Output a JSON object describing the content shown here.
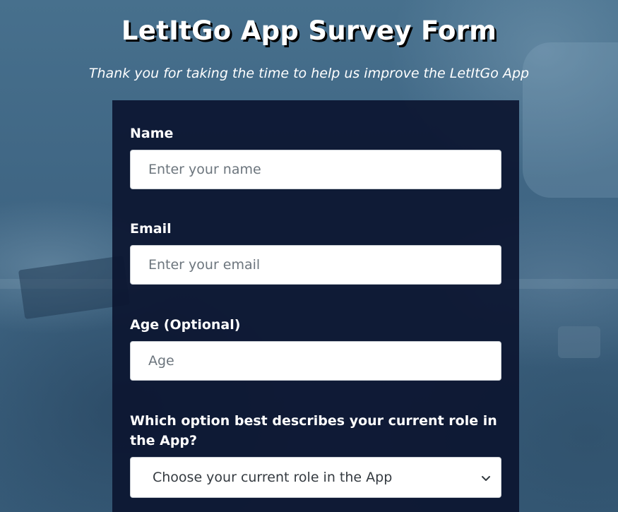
{
  "header": {
    "title": "LetItGo App Survey Form",
    "subtitle": "Thank you for taking the time to help us improve the LetItGo App"
  },
  "form": {
    "name": {
      "label": "Name",
      "placeholder": "Enter your name",
      "value": ""
    },
    "email": {
      "label": "Email",
      "placeholder": "Enter your email",
      "value": ""
    },
    "age": {
      "label": "Age (Optional)",
      "placeholder": "Age",
      "value": ""
    },
    "role": {
      "label": "Which option best describes your current role in the App?",
      "selected": "Choose your current role in the App",
      "icon": "chevron-down-icon"
    }
  },
  "colors": {
    "background": "#3f6480",
    "panel": "#0c1630",
    "text": "#ffffff"
  }
}
